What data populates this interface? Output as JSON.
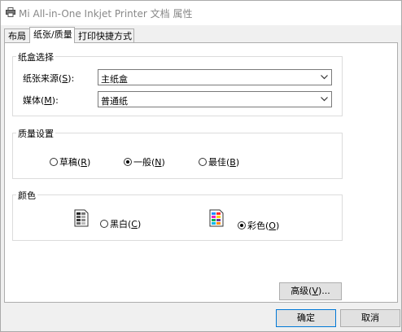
{
  "window": {
    "title": "Mi All-in-One Inkjet Printer 文档 属性",
    "icon": "printer-icon"
  },
  "tabs": [
    {
      "label": "布局",
      "active": false
    },
    {
      "label": "纸张/质量",
      "active": true
    },
    {
      "label": "打印快捷方式",
      "active": false
    }
  ],
  "tray_group": {
    "title": "纸盒选择",
    "source_label": "纸张来源(",
    "source_key": "S",
    "source_suffix": "):",
    "source_value": "主纸盒",
    "media_label": "媒体(",
    "media_key": "M",
    "media_suffix": "):",
    "media_value": "普通纸"
  },
  "quality_group": {
    "title": "质量设置",
    "options": [
      {
        "label": "草稿(",
        "key": "R",
        "suffix": ")",
        "checked": false
      },
      {
        "label": "一般(",
        "key": "N",
        "suffix": ")",
        "checked": true
      },
      {
        "label": "最佳(",
        "key": "B",
        "suffix": ")",
        "checked": false
      }
    ]
  },
  "color_group": {
    "title": "颜色",
    "options": [
      {
        "label": "黑白(",
        "key": "C",
        "suffix": ")",
        "checked": false,
        "icon": "grayscale-document-icon"
      },
      {
        "label": "彩色(",
        "key": "O",
        "suffix": ")",
        "checked": true,
        "icon": "color-document-icon"
      }
    ]
  },
  "buttons": {
    "advanced_label": "高级(",
    "advanced_key": "V",
    "advanced_suffix": ")...",
    "ok_label": "确定",
    "cancel_label": "取消"
  },
  "colors": {
    "accent": "#0078d7",
    "background": "#f0f0f0",
    "panel": "#ffffff"
  }
}
